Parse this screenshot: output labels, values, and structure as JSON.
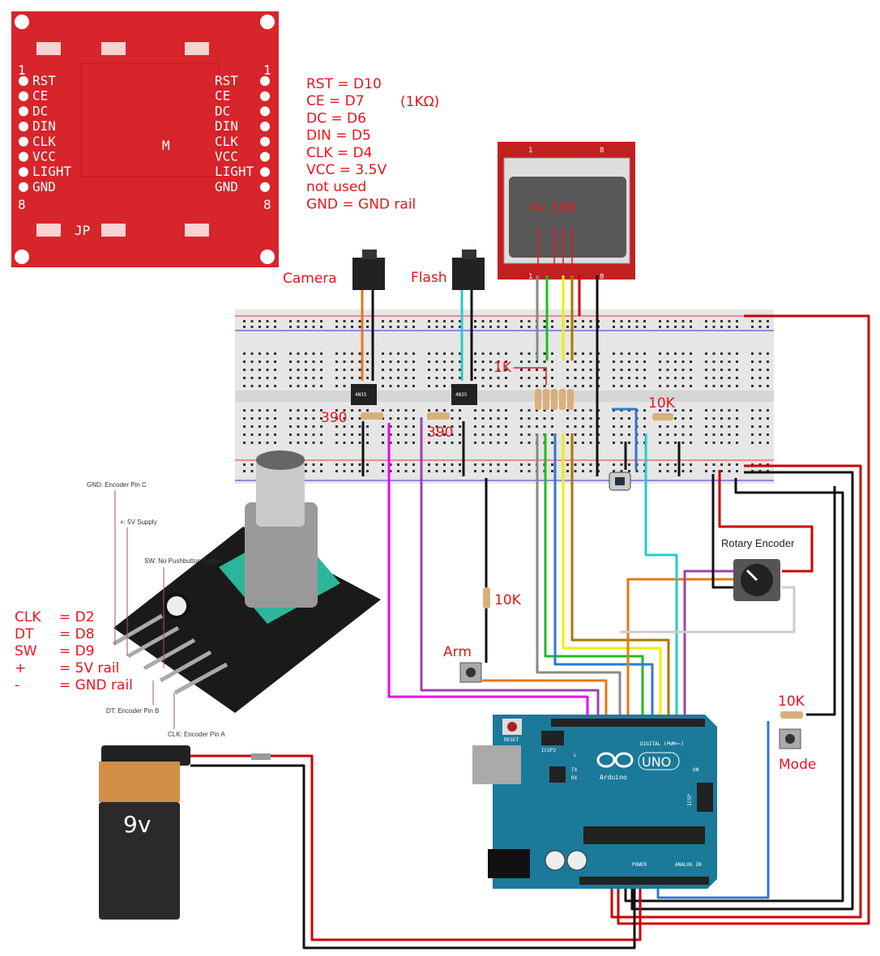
{
  "lcd_module": {
    "left_pins": [
      "RST",
      "CE",
      "DC",
      "DIN",
      "CLK",
      "VCC",
      "LIGHT",
      "GND"
    ],
    "right_pins": [
      "RST",
      "CE",
      "DC",
      "DIN",
      "CLK",
      "VCC",
      "LIGHT",
      "GND"
    ],
    "pin1": "1",
    "pin8": "8",
    "jp": "JP",
    "m": "M"
  },
  "lcd_mapping": [
    "RST = D10",
    "CE   = D7",
    "DC   = D6",
    "DIN  = D5",
    "CLK = D4",
    "VCC = 3.5V",
    "not used",
    "GND = GND rail"
  ],
  "lcd_mapping_note": "(1KΩ)",
  "nokia": {
    "resistor_label": "4x 10K",
    "pin1": "1",
    "pin8": "8"
  },
  "jacks": {
    "camera": "Camera",
    "flash": "Flash"
  },
  "optocoupler": {
    "label": "4N35"
  },
  "resistors": {
    "r390_a": "390",
    "r390_b": "390",
    "r1k": "1K",
    "r10k_bb": "10K",
    "r10k_arm": "10K",
    "r10k_mode": "10K"
  },
  "buttons": {
    "arm": "Arm",
    "mode": "Mode"
  },
  "rotary_encoder_label": "Rotary Encoder",
  "encoder_photo": {
    "gnd": "GND: Encoder Pin C",
    "plus": "+: 5V Supply",
    "sw": "SW: No Pushbutton Switch",
    "dt": "DT: Encoder Pin B",
    "clk": "CLK: Encoder Pin A"
  },
  "encoder_mapping": [
    {
      "pin": "CLK",
      "val": "= D2"
    },
    {
      "pin": "DT",
      "val": "= D8"
    },
    {
      "pin": "SW",
      "val": "= D9"
    },
    {
      "pin": "+",
      "val": "= 5V rail"
    },
    {
      "pin": "-",
      "val": "= GND rail"
    }
  ],
  "battery": {
    "label": "9v"
  },
  "arduino": {
    "logo": "Arduino",
    "model": "UNO",
    "reset": "RESET",
    "icsp2": "ICSP2",
    "icsp": "ICSP",
    "digital": "DIGITAL (PWM=~)",
    "power": "POWER",
    "analog": "ANALOG IN",
    "led_l": "L",
    "led_tx": "TX",
    "led_rx": "RX",
    "led_on": "ON"
  },
  "colors": {
    "annotation": "#e8141b",
    "pcb_red": "#d8242b",
    "arduino": "#1b7a99",
    "wire_red": "#c00000"
  }
}
